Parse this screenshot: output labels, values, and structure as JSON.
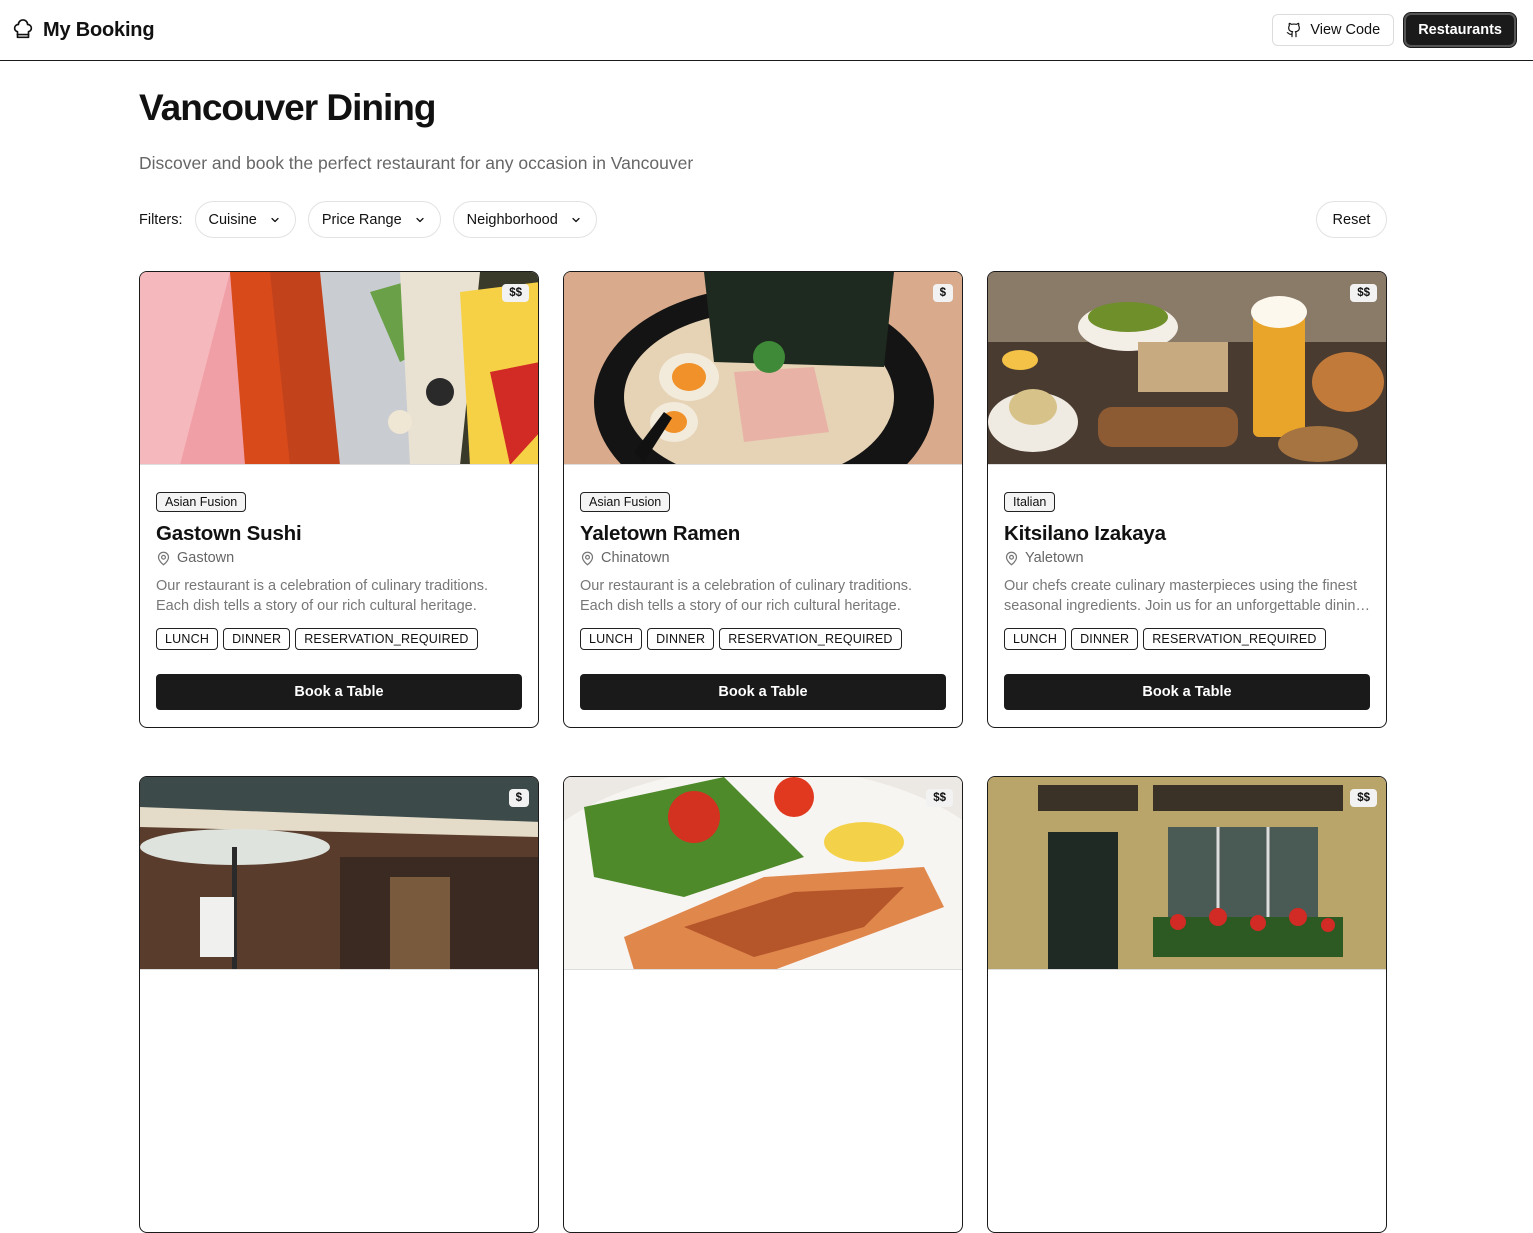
{
  "header": {
    "brand_icon": "chef-hat-icon",
    "title": "My Booking",
    "view_code_label": "View Code",
    "view_code_icon": "github-icon",
    "restaurants_label": "Restaurants"
  },
  "page": {
    "title": "Vancouver Dining",
    "subtitle": "Discover and book the perfect restaurant for any occasion in Vancouver"
  },
  "filters": {
    "label": "Filters:",
    "cuisine": "Cuisine",
    "price_range": "Price Range",
    "neighborhood": "Neighborhood",
    "reset": "Reset"
  },
  "restaurants": [
    {
      "price": "$$",
      "cuisine": "Asian Fusion",
      "name": "Gastown Sushi",
      "location": "Gastown",
      "description": "Our restaurant is a celebration of culinary traditions. Each dish tells a story of our rich cultural heritage.",
      "meals": [
        "LUNCH",
        "DINNER",
        "RESERVATION_REQUIRED"
      ],
      "cta": "Book a Table",
      "image": "sushi-platter"
    },
    {
      "price": "$",
      "cuisine": "Asian Fusion",
      "name": "Yaletown Ramen",
      "location": "Chinatown",
      "description": "Our restaurant is a celebration of culinary traditions. Each dish tells a story of our rich cultural heritage.",
      "meals": [
        "LUNCH",
        "DINNER",
        "RESERVATION_REQUIRED"
      ],
      "cta": "Book a Table",
      "image": "ramen-bowl"
    },
    {
      "price": "$$",
      "cuisine": "Italian",
      "name": "Kitsilano Izakaya",
      "location": "Yaletown",
      "description": "Our chefs create culinary masterpieces using the finest seasonal ingredients. Join us for an unforgettable dining experience.",
      "meals": [
        "LUNCH",
        "DINNER",
        "RESERVATION_REQUIRED"
      ],
      "cta": "Book a Table",
      "image": "izakaya-spread"
    },
    {
      "price": "$",
      "image": "paris-cafe-terrace"
    },
    {
      "price": "$$",
      "image": "salmon-salad"
    },
    {
      "price": "$$",
      "image": "german-pub-facade"
    }
  ],
  "colors": {
    "primary": "#1a1a1a",
    "muted_text": "#666666",
    "border": "#e2e2e2"
  }
}
